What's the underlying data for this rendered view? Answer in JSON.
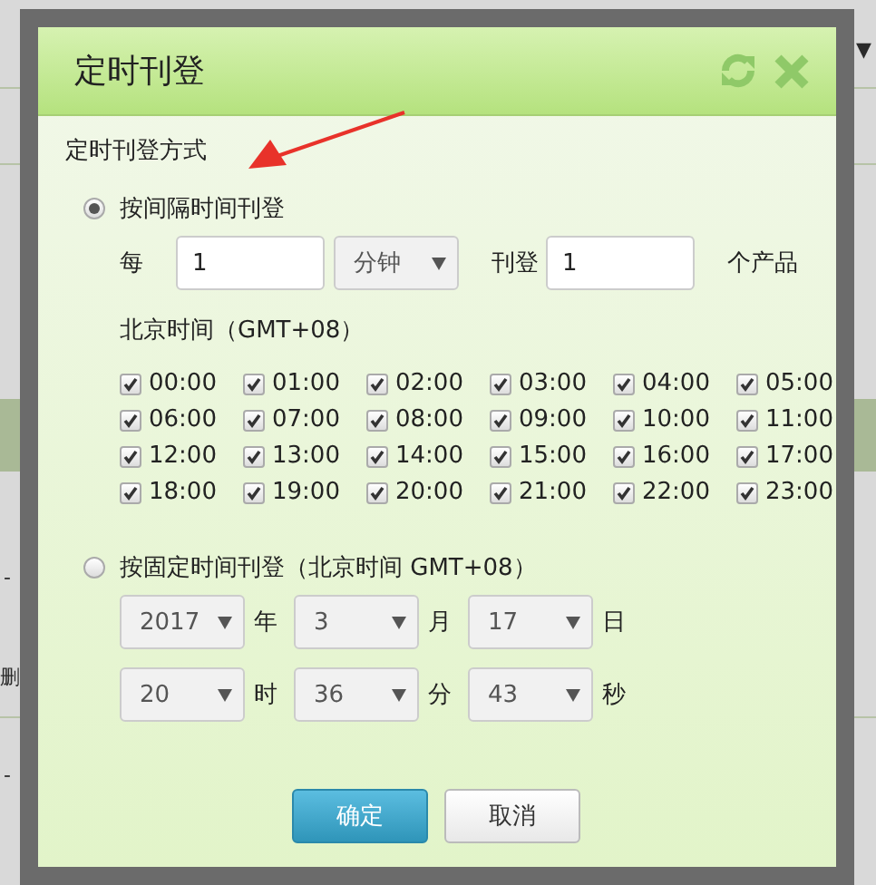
{
  "background": {
    "fragments": [
      {
        "text": "▼"
      },
      {
        "text": "-"
      },
      {
        "text": "删"
      },
      {
        "text": "-"
      }
    ]
  },
  "dialog": {
    "title": "定时刊登",
    "section_label": "定时刊登方式",
    "modes": [
      {
        "label": "按间隔时间刊登",
        "selected": true
      },
      {
        "label": "按固定时间刊登（北京时间 GMT+08）",
        "selected": false
      }
    ],
    "interval": {
      "prefix": "每",
      "every": "1",
      "unit": "分钟",
      "middle": "刊登",
      "count": "1",
      "suffix": "个产品"
    },
    "timezone_label": "北京时间（GMT+08）",
    "hours": [
      {
        "label": "00:00",
        "checked": true
      },
      {
        "label": "01:00",
        "checked": true
      },
      {
        "label": "02:00",
        "checked": true
      },
      {
        "label": "03:00",
        "checked": true
      },
      {
        "label": "04:00",
        "checked": true
      },
      {
        "label": "05:00",
        "checked": true
      },
      {
        "label": "06:00",
        "checked": true
      },
      {
        "label": "07:00",
        "checked": true
      },
      {
        "label": "08:00",
        "checked": true
      },
      {
        "label": "09:00",
        "checked": true
      },
      {
        "label": "10:00",
        "checked": true
      },
      {
        "label": "11:00",
        "checked": true
      },
      {
        "label": "12:00",
        "checked": true
      },
      {
        "label": "13:00",
        "checked": true
      },
      {
        "label": "14:00",
        "checked": true
      },
      {
        "label": "15:00",
        "checked": true
      },
      {
        "label": "16:00",
        "checked": true
      },
      {
        "label": "17:00",
        "checked": true
      },
      {
        "label": "18:00",
        "checked": true
      },
      {
        "label": "19:00",
        "checked": true
      },
      {
        "label": "20:00",
        "checked": true
      },
      {
        "label": "21:00",
        "checked": true
      },
      {
        "label": "22:00",
        "checked": true
      },
      {
        "label": "23:00",
        "checked": true
      }
    ],
    "fixed_date": [
      {
        "value": "2017",
        "unit": "年"
      },
      {
        "value": "3",
        "unit": "月"
      },
      {
        "value": "17",
        "unit": "日"
      }
    ],
    "fixed_time": [
      {
        "value": "20",
        "unit": "时"
      },
      {
        "value": "36",
        "unit": "分"
      },
      {
        "value": "43",
        "unit": "秒"
      }
    ],
    "buttons": [
      {
        "label": "确定",
        "kind": "primary"
      },
      {
        "label": "取消",
        "kind": "default"
      }
    ]
  }
}
